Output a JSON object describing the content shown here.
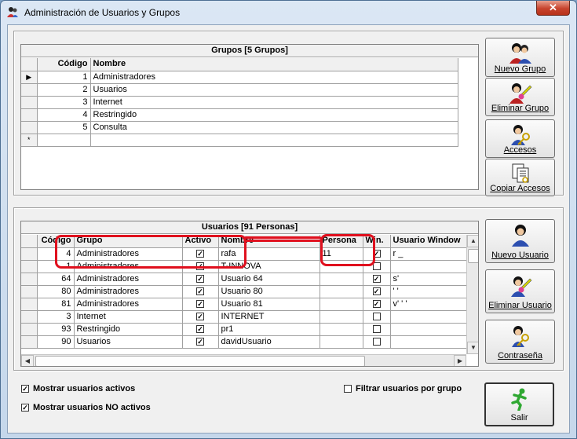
{
  "window": {
    "title": "Administración de Usuarios y Grupos",
    "close_label": "✕",
    "icon": "users-app-icon"
  },
  "grupos": {
    "caption": "Grupos [5 Grupos]",
    "columns": [
      "Código",
      "Nombre"
    ],
    "rows": [
      {
        "codigo": "1",
        "nombre": "Administradores",
        "current": true
      },
      {
        "codigo": "2",
        "nombre": "Usuarios"
      },
      {
        "codigo": "3",
        "nombre": "Internet"
      },
      {
        "codigo": "4",
        "nombre": "Restringido"
      },
      {
        "codigo": "5",
        "nombre": "Consulta"
      }
    ],
    "new_row_marker": "*",
    "current_row_marker": "▶"
  },
  "grupo_buttons": [
    {
      "label": "Nuevo Grupo",
      "icon": "new-group-icon"
    },
    {
      "label": "Eliminar Grupo",
      "icon": "delete-group-icon"
    },
    {
      "label": "Accesos",
      "icon": "access-key-icon"
    },
    {
      "label": "Copiar Accesos",
      "icon": "copy-access-icon"
    }
  ],
  "usuarios": {
    "caption": "Usuarios [91 Personas]",
    "columns": [
      "Código",
      "Grupo",
      "Activo",
      "Nombre",
      "Persona",
      "Win.",
      "Usuario Window"
    ],
    "rows": [
      {
        "codigo": "4",
        "grupo": "Administradores",
        "activo": true,
        "nombre": "rafa",
        "persona": "11",
        "win": true,
        "usuario_windows": "r  _"
      },
      {
        "codigo": "1",
        "grupo": "Administradores",
        "activo": true,
        "nombre": "T-INNOVA",
        "persona": "",
        "win": false,
        "usuario_windows": ""
      },
      {
        "codigo": "64",
        "grupo": "Administradores",
        "activo": true,
        "nombre": "Usuario 64",
        "persona": "",
        "win": true,
        "usuario_windows": "s'"
      },
      {
        "codigo": "80",
        "grupo": "Administradores",
        "activo": true,
        "nombre": "Usuario 80",
        "persona": "",
        "win": true,
        "usuario_windows": "' '"
      },
      {
        "codigo": "81",
        "grupo": "Administradores",
        "activo": true,
        "nombre": "Usuario 81",
        "persona": "",
        "win": true,
        "usuario_windows": "v' ' '"
      },
      {
        "codigo": "3",
        "grupo": "Internet",
        "activo": true,
        "nombre": "INTERNET",
        "persona": "",
        "win": false,
        "usuario_windows": ""
      },
      {
        "codigo": "93",
        "grupo": "Restringido",
        "activo": true,
        "nombre": "pr1",
        "persona": "",
        "win": false,
        "usuario_windows": ""
      },
      {
        "codigo": "90",
        "grupo": "Usuarios",
        "activo": true,
        "nombre": "davidUsuario",
        "persona": "",
        "win": false,
        "usuario_windows": ""
      }
    ]
  },
  "usuario_buttons": [
    {
      "label": "Nuevo Usuario",
      "icon": "new-user-icon"
    },
    {
      "label": "Eliminar Usuario",
      "icon": "delete-user-icon"
    },
    {
      "label": "Contraseña",
      "icon": "password-key-icon"
    }
  ],
  "options": {
    "mostrar_activos": {
      "label": "Mostrar usuarios activos",
      "checked": true
    },
    "mostrar_no_activos": {
      "label": "Mostrar usuarios NO activos",
      "checked": true
    },
    "filtrar_por_grupo": {
      "label": "Filtrar usuarios por grupo",
      "checked": false
    }
  },
  "salir_button": {
    "label": "Salir",
    "icon": "running-man-exit-icon"
  },
  "colors": {
    "annotation_red": "#e0101e",
    "title_bar": "#c5d7eb",
    "exit_green": "#2fa832"
  }
}
